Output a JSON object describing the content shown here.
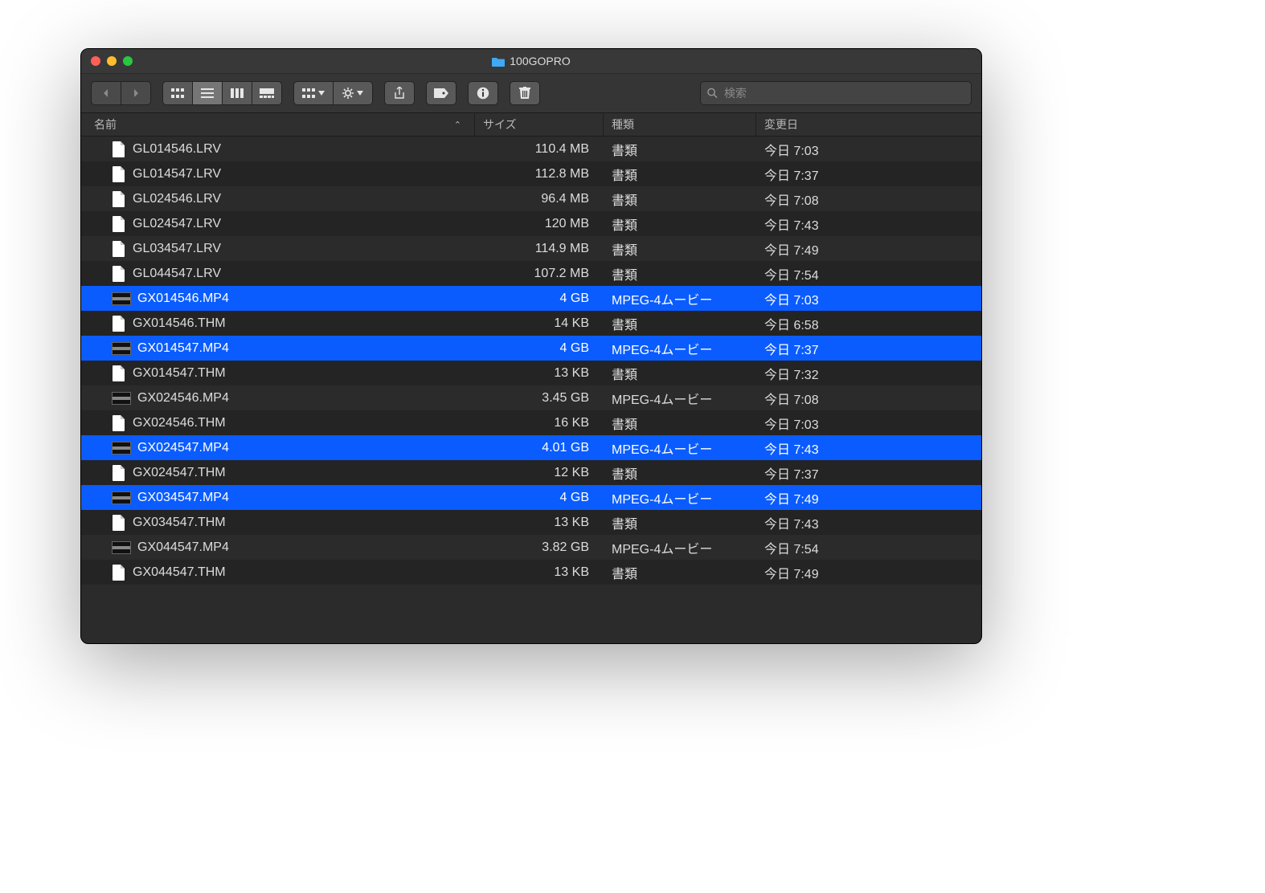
{
  "window": {
    "title": "100GOPRO"
  },
  "search": {
    "placeholder": "検索"
  },
  "columns": {
    "name": "名前",
    "size": "サイズ",
    "kind": "種類",
    "date": "変更日"
  },
  "icons": {
    "doc": "document-icon",
    "vid": "video-thumb-icon"
  },
  "files": [
    {
      "name": "GL014546.LRV",
      "size": "110.4 MB",
      "kind": "書類",
      "date": "今日 7:03",
      "icon": "doc",
      "selected": false
    },
    {
      "name": "GL014547.LRV",
      "size": "112.8 MB",
      "kind": "書類",
      "date": "今日 7:37",
      "icon": "doc",
      "selected": false
    },
    {
      "name": "GL024546.LRV",
      "size": "96.4 MB",
      "kind": "書類",
      "date": "今日 7:08",
      "icon": "doc",
      "selected": false
    },
    {
      "name": "GL024547.LRV",
      "size": "120 MB",
      "kind": "書類",
      "date": "今日 7:43",
      "icon": "doc",
      "selected": false
    },
    {
      "name": "GL034547.LRV",
      "size": "114.9 MB",
      "kind": "書類",
      "date": "今日 7:49",
      "icon": "doc",
      "selected": false
    },
    {
      "name": "GL044547.LRV",
      "size": "107.2 MB",
      "kind": "書類",
      "date": "今日 7:54",
      "icon": "doc",
      "selected": false
    },
    {
      "name": "GX014546.MP4",
      "size": "4 GB",
      "kind": "MPEG-4ムービー",
      "date": "今日 7:03",
      "icon": "vid",
      "selected": true
    },
    {
      "name": "GX014546.THM",
      "size": "14 KB",
      "kind": "書類",
      "date": "今日 6:58",
      "icon": "doc",
      "selected": false
    },
    {
      "name": "GX014547.MP4",
      "size": "4 GB",
      "kind": "MPEG-4ムービー",
      "date": "今日 7:37",
      "icon": "vid",
      "selected": true
    },
    {
      "name": "GX014547.THM",
      "size": "13 KB",
      "kind": "書類",
      "date": "今日 7:32",
      "icon": "doc",
      "selected": false
    },
    {
      "name": "GX024546.MP4",
      "size": "3.45 GB",
      "kind": "MPEG-4ムービー",
      "date": "今日 7:08",
      "icon": "vid",
      "selected": false
    },
    {
      "name": "GX024546.THM",
      "size": "16 KB",
      "kind": "書類",
      "date": "今日 7:03",
      "icon": "doc",
      "selected": false
    },
    {
      "name": "GX024547.MP4",
      "size": "4.01 GB",
      "kind": "MPEG-4ムービー",
      "date": "今日 7:43",
      "icon": "vid",
      "selected": true
    },
    {
      "name": "GX024547.THM",
      "size": "12 KB",
      "kind": "書類",
      "date": "今日 7:37",
      "icon": "doc",
      "selected": false
    },
    {
      "name": "GX034547.MP4",
      "size": "4 GB",
      "kind": "MPEG-4ムービー",
      "date": "今日 7:49",
      "icon": "vid",
      "selected": true
    },
    {
      "name": "GX034547.THM",
      "size": "13 KB",
      "kind": "書類",
      "date": "今日 7:43",
      "icon": "doc",
      "selected": false
    },
    {
      "name": "GX044547.MP4",
      "size": "3.82 GB",
      "kind": "MPEG-4ムービー",
      "date": "今日 7:54",
      "icon": "vid",
      "selected": false
    },
    {
      "name": "GX044547.THM",
      "size": "13 KB",
      "kind": "書類",
      "date": "今日 7:49",
      "icon": "doc",
      "selected": false
    }
  ]
}
